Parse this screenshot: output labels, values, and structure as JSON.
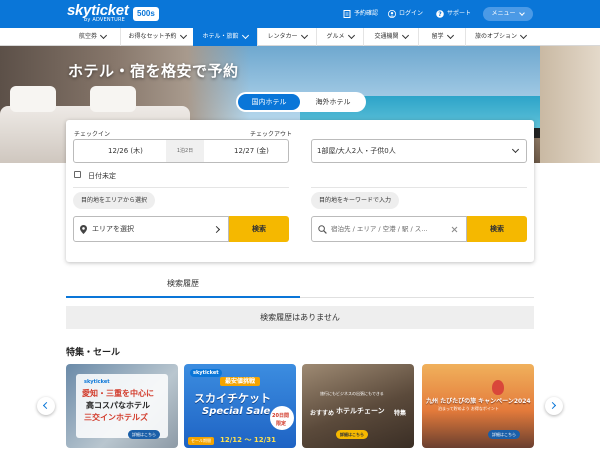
{
  "header": {
    "logo": "skyticket",
    "logo_sub": "by ADVENTURE",
    "badge": "500s",
    "links": [
      "予約確認",
      "ログイン",
      "サポート"
    ],
    "menu": "メニュー"
  },
  "nav": {
    "items": [
      "航空券",
      "お得なセット予約",
      "ホテル・旅館",
      "レンタカー",
      "グルメ",
      "交通機関",
      "留学",
      "旅のオプション"
    ],
    "active_index": 2
  },
  "hero": {
    "title": "ホテル・宿を格安で予約",
    "tabs": [
      "国内ホテル",
      "海外ホテル"
    ],
    "active_tab": 0
  },
  "search": {
    "checkin_label": "チェックイン",
    "checkout_label": "チェックアウト",
    "checkin_value": "12/26 (木)",
    "nights": "1泊2日",
    "checkout_value": "12/27 (金)",
    "rooms_value": "1部屋/大人2人・子供0人",
    "undecided_label": "日付未定",
    "area_label": "目的地をエリアから選択",
    "area_value": "エリアを選択",
    "keyword_label": "目的地をキーワードで入力",
    "keyword_placeholder": "宿泊先 / エリア / 空港 / 駅 / ス…",
    "search_button": "検索"
  },
  "history": {
    "tab": "検索履歴",
    "empty": "検索履歴はありません"
  },
  "features": {
    "title": "特集・セール",
    "banners": [
      {
        "brand": "skyticket",
        "line1": "愛知・三重を中心に",
        "line2": "高コスパなホテル",
        "line3": "三交インホテルズ",
        "detail": "詳細はこちら"
      },
      {
        "brand": "skyticket",
        "ribbon": "最安値挑戦",
        "line1": "スカイチケット",
        "line2": "Special Sale",
        "side": "20日間",
        "side2": "限定",
        "tag": "セール期間",
        "period": "12/12 〜 12/31"
      },
      {
        "line0": "旅行にもビジネスの出張にもできる",
        "line1": "おすすめ",
        "line2": "ホテルチェーン",
        "line3": "特集",
        "detail": "詳細はこちら"
      },
      {
        "line1": "九州 たびたびの旅 キャンペーン2024",
        "line2": "泊まって貯めよう お得なポイント",
        "detail": "詳細はこちら"
      }
    ]
  },
  "colors": {
    "brand_blue": "#0a76d8",
    "search_yellow": "#f5b800"
  }
}
